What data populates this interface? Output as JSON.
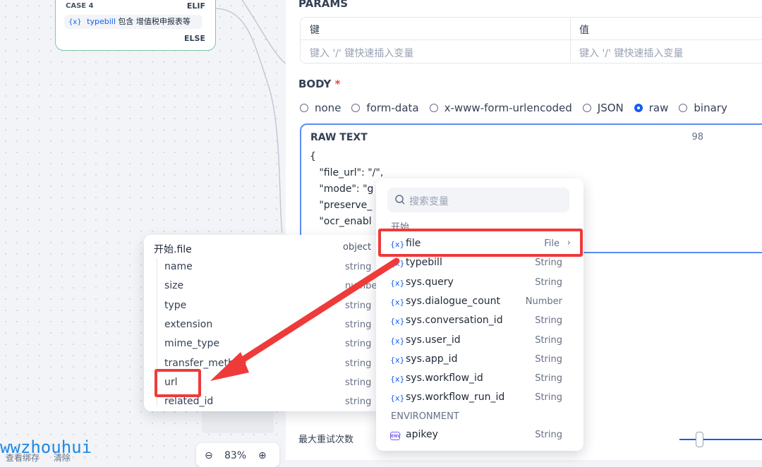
{
  "canvas": {
    "node": {
      "case_label": "CASE 4",
      "elif_label": "ELIF",
      "condition": {
        "var": "typebill",
        "op": "包含",
        "value": "增值税申报表等"
      },
      "else_label": "ELSE"
    },
    "zoom": "83%",
    "bottom_links": [
      "查看绑存",
      "清除"
    ],
    "watermark": "wwzhouhui"
  },
  "panel": {
    "params_title": "PARAMS",
    "params_headers": {
      "key": "键",
      "value": "值"
    },
    "params_placeholders": {
      "key": "键入 '/' 键快速插入变量",
      "value": "键入 '/' 键快速插入变量"
    },
    "body_title": "BODY",
    "body_required": "*",
    "body_types": [
      "none",
      "form-data",
      "x-www-form-urlencoded",
      "JSON",
      "raw",
      "binary"
    ],
    "body_selected": "raw",
    "raw_label": "RAW TEXT",
    "raw_count": "98",
    "raw_lines": [
      "{",
      "   \"file_url\": \"/\",",
      "   \"mode\": \"g",
      "   \"preserve_",
      "   \"ocr_enabl"
    ],
    "retry_label": "最大重试次数"
  },
  "file_props": {
    "header": {
      "name": "开始.file",
      "type": "object"
    },
    "items": [
      {
        "name": "name",
        "type": "string"
      },
      {
        "name": "size",
        "type": "number"
      },
      {
        "name": "type",
        "type": "string"
      },
      {
        "name": "extension",
        "type": "string"
      },
      {
        "name": "mime_type",
        "type": "string"
      },
      {
        "name": "transfer_method",
        "type": "string"
      },
      {
        "name": "url",
        "type": "string"
      },
      {
        "name": "related_id",
        "type": "string"
      }
    ]
  },
  "var_dropdown": {
    "search_placeholder": "搜索变量",
    "group_start": "开始",
    "start_vars": [
      {
        "name": "file",
        "type": "File"
      },
      {
        "name": "typebill",
        "type": "String"
      },
      {
        "name": "sys.query",
        "type": "String"
      },
      {
        "name": "sys.dialogue_count",
        "type": "Number"
      },
      {
        "name": "sys.conversation_id",
        "type": "String"
      },
      {
        "name": "sys.user_id",
        "type": "String"
      },
      {
        "name": "sys.app_id",
        "type": "String"
      },
      {
        "name": "sys.workflow_id",
        "type": "String"
      },
      {
        "name": "sys.workflow_run_id",
        "type": "String"
      }
    ],
    "group_env": "ENVIRONMENT",
    "env_vars": [
      {
        "name": "apikey",
        "type": "String"
      }
    ]
  },
  "colors": {
    "accent": "#155eef",
    "highlight": "#ef3a3a",
    "node_border": "#7fc8a9"
  }
}
